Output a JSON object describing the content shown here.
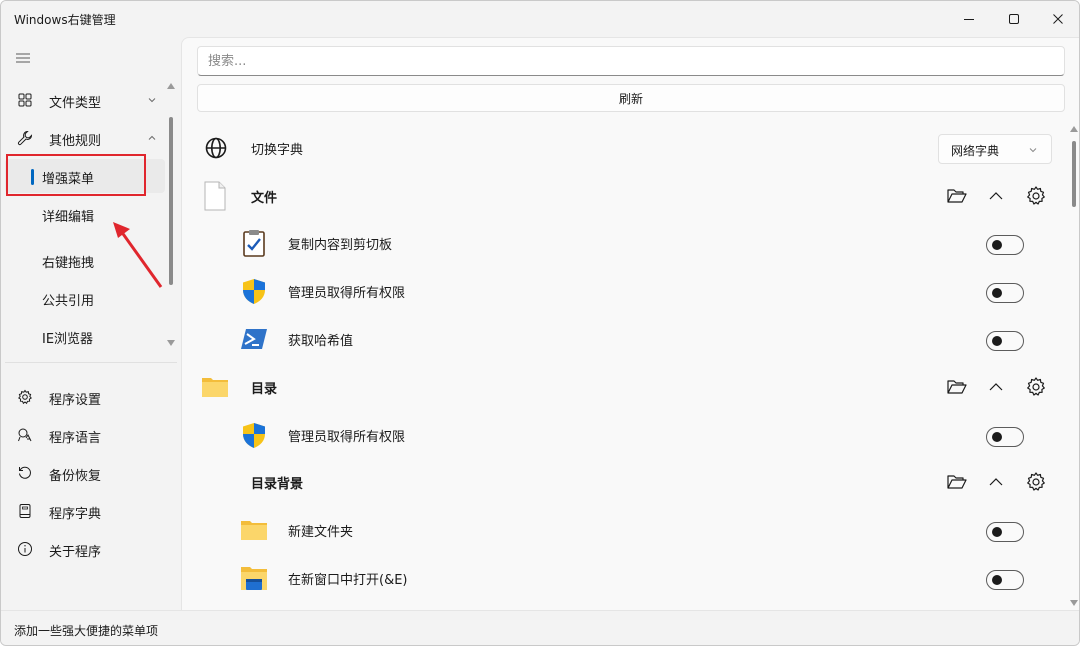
{
  "window": {
    "title": "Windows右键管理"
  },
  "sidebar": {
    "items": [
      {
        "label": "文件类型",
        "icon": "grid-icon"
      },
      {
        "label": "其他规则",
        "icon": "wrench-icon"
      }
    ],
    "sub_items": [
      {
        "label": "增强菜单",
        "selected": true
      },
      {
        "label": "详细编辑"
      },
      {
        "label": "右键拖拽"
      },
      {
        "label": "公共引用"
      },
      {
        "label": "IE浏览器"
      }
    ],
    "footer_items": [
      {
        "label": "程序设置",
        "icon": "gear-icon"
      },
      {
        "label": "程序语言",
        "icon": "translate-icon"
      },
      {
        "label": "备份恢复",
        "icon": "restore-icon"
      },
      {
        "label": "程序字典",
        "icon": "book-icon"
      },
      {
        "label": "关于程序",
        "icon": "info-icon"
      }
    ]
  },
  "main": {
    "search_placeholder": "搜索...",
    "refresh_label": "刷新",
    "dictionary": {
      "label": "切换字典",
      "selected": "网络字典"
    },
    "sections": [
      {
        "title": "文件",
        "items": [
          {
            "label": "复制内容到剪切板",
            "icon": "clipboard-icon",
            "enabled": false
          },
          {
            "label": "管理员取得所有权限",
            "icon": "shield-icon",
            "enabled": false
          },
          {
            "label": "获取哈希值",
            "icon": "powershell-icon",
            "enabled": false
          }
        ]
      },
      {
        "title": "目录",
        "items": [
          {
            "label": "管理员取得所有权限",
            "icon": "shield-icon",
            "enabled": false
          }
        ]
      },
      {
        "title": "目录背景",
        "items": [
          {
            "label": "新建文件夹",
            "icon": "folder-icon",
            "enabled": false
          },
          {
            "label": "在新窗口中打开(&E)",
            "icon": "folder-window-icon",
            "enabled": false
          }
        ]
      }
    ]
  },
  "status": {
    "text": "添加一些强大便捷的菜单项"
  }
}
